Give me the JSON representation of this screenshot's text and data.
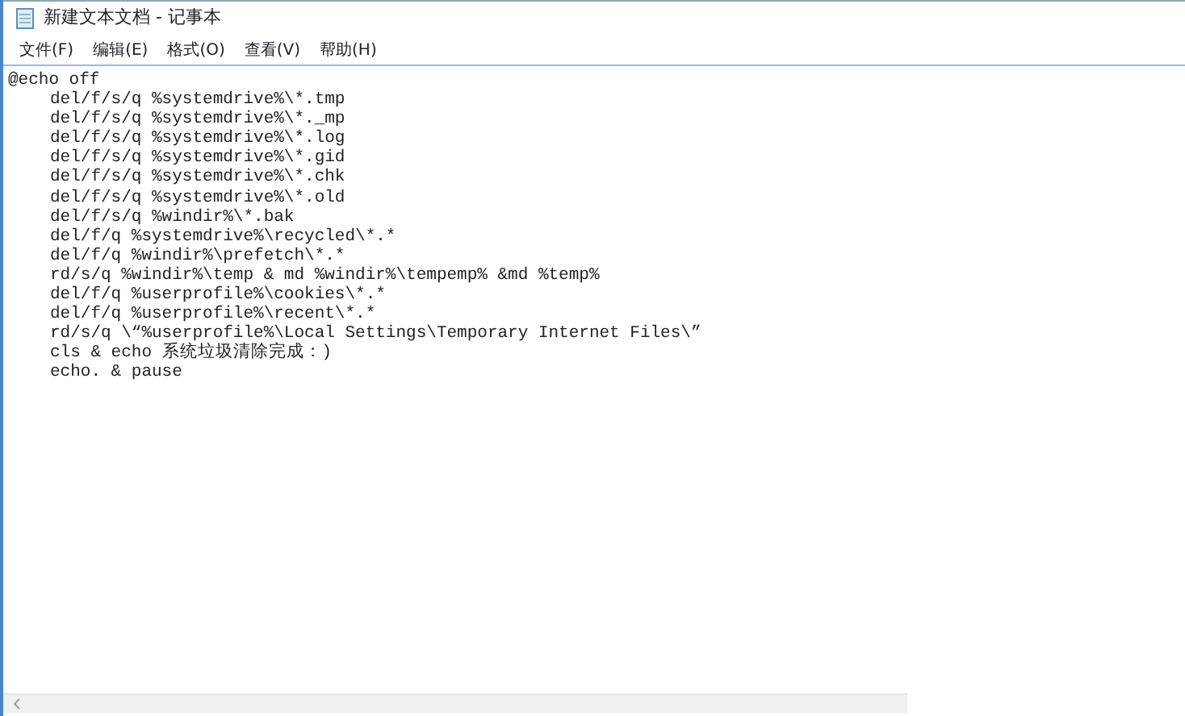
{
  "window": {
    "title": "新建文本文档 - 记事本"
  },
  "menu": [
    "文件(F)",
    "编辑(E)",
    "格式(O)",
    "查看(V)",
    "帮助(H)"
  ],
  "lines": [
    {
      "text": "@echo off",
      "children": [
        {
          "text": "del/f/s/q %systemdrive%\\*.tmp"
        },
        {
          "text": "del/f/s/q %systemdrive%\\*._mp"
        },
        {
          "text": "del/f/s/q %systemdrive%\\*.log"
        },
        {
          "text": "del/f/s/q %systemdrive%\\*.gid"
        },
        {
          "text": "del/f/s/q %systemdrive%\\*.chk"
        },
        {
          "text": "del/f/s/q %systemdrive%\\*.old"
        },
        {
          "text": "del/f/s/q %windir%\\*.bak"
        },
        {
          "text": "del/f/q %systemdrive%\\recycled\\*.*"
        },
        {
          "text": "del/f/q %windir%\\prefetch\\*.*"
        },
        {
          "text": "rd/s/q %windir%\\temp & md %windir%\\tempemp% &md %temp%"
        },
        {
          "text": "del/f/q %userprofile%\\cookies\\*.*"
        },
        {
          "text": "del/f/q %userprofile%\\recent\\*.*"
        },
        {
          "text": "rd/s/q \\“%userprofile%\\Local Settings\\Temporary Internet Files\\”"
        },
        {
          "text": "cls & echo 系统垃圾清除完成：)"
        },
        {
          "text": "echo. & pause"
        }
      ]
    }
  ]
}
